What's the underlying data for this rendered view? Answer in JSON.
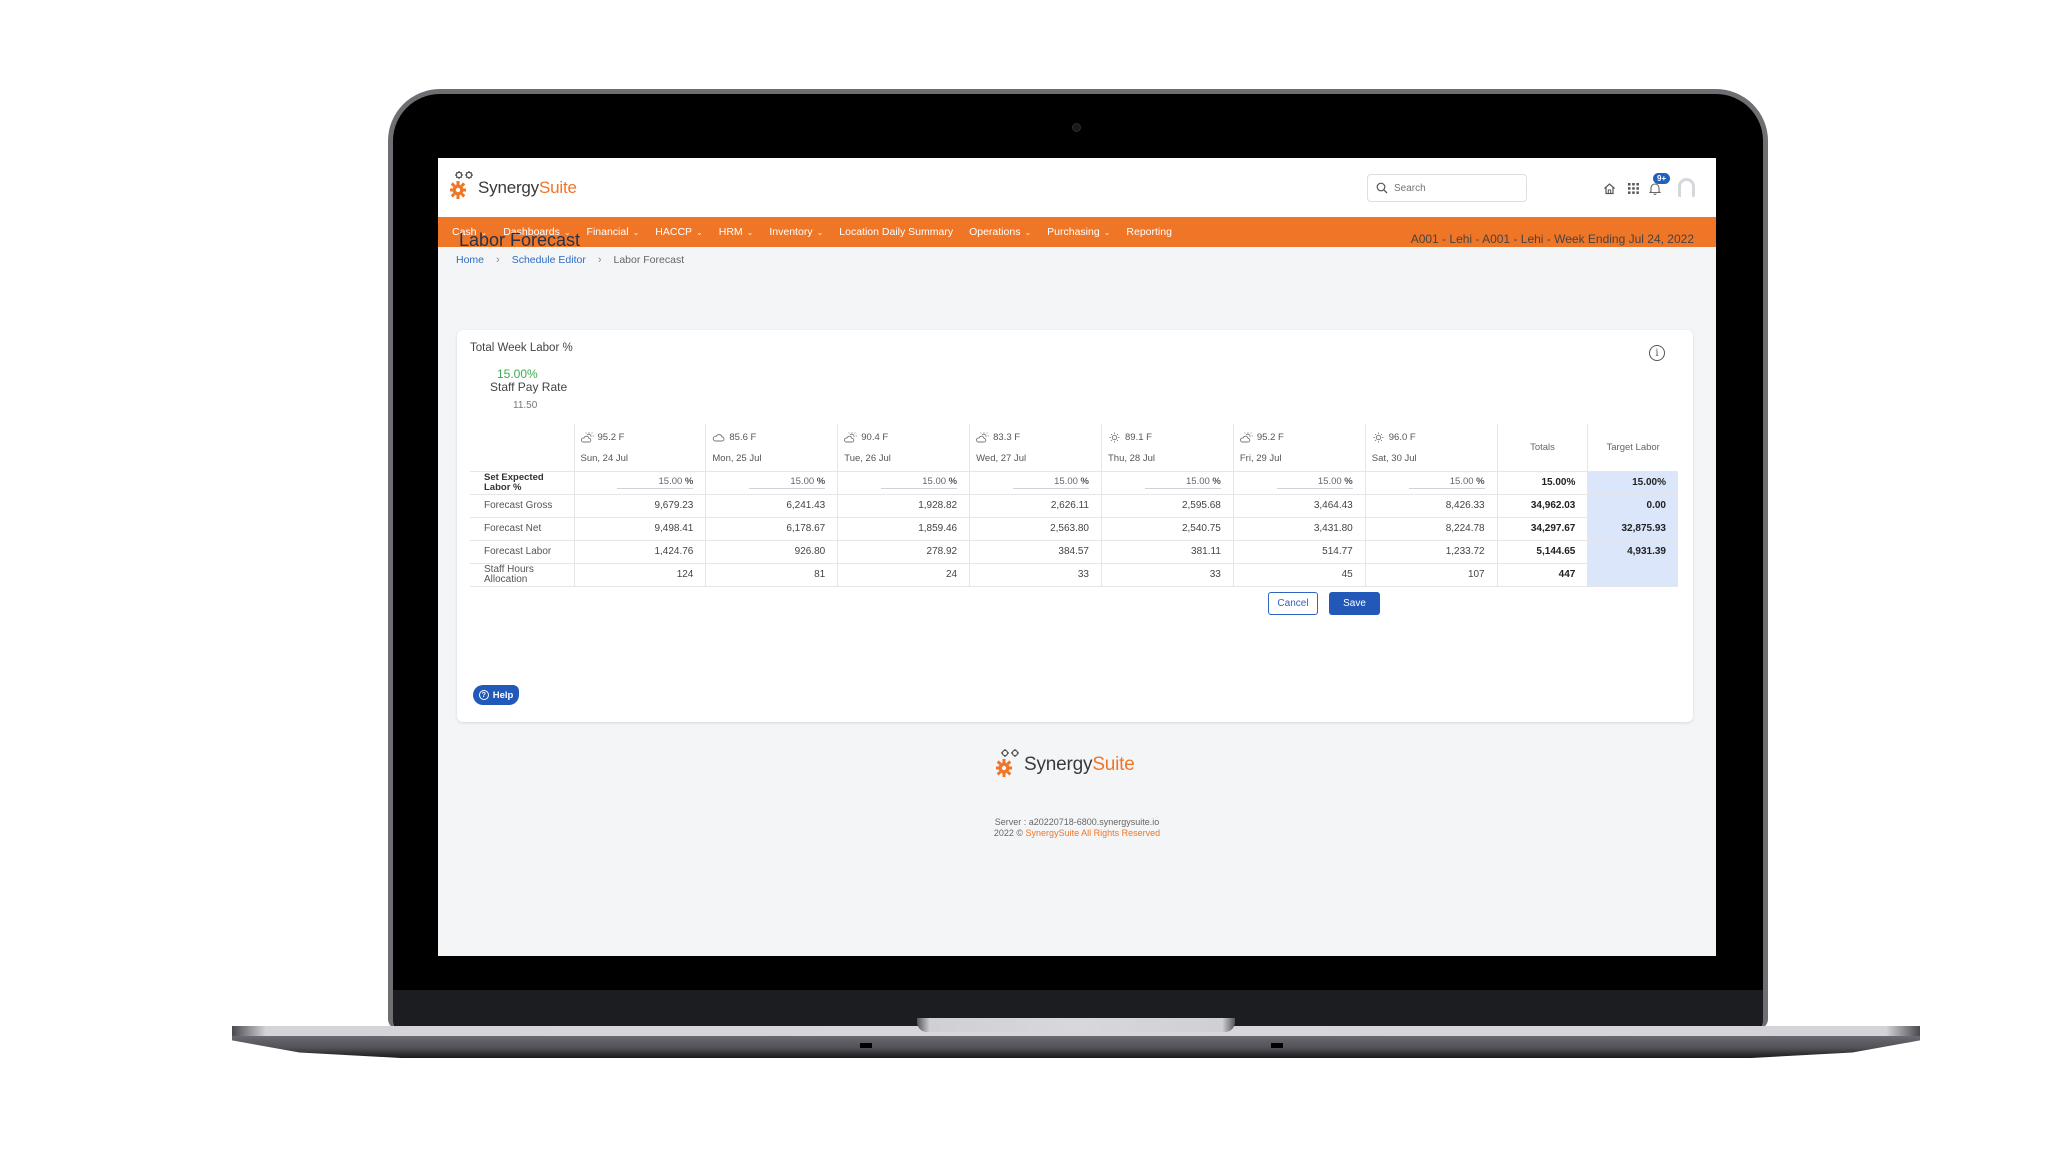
{
  "app": {
    "brand_primary": "Synergy",
    "brand_secondary": "Suite",
    "accent_color": "#ef7627",
    "link_color": "#2f6cc2"
  },
  "header": {
    "search_placeholder": "Search",
    "notification_badge": "9+",
    "icons": [
      "home-icon",
      "apps-grid-icon",
      "bell-icon",
      "avatar"
    ]
  },
  "nav": {
    "items": [
      {
        "label": "Cash",
        "dropdown": true
      },
      {
        "label": "Dashboards",
        "dropdown": true
      },
      {
        "label": "Financial",
        "dropdown": true
      },
      {
        "label": "HACCP",
        "dropdown": true
      },
      {
        "label": "HRM",
        "dropdown": true
      },
      {
        "label": "Inventory",
        "dropdown": true
      },
      {
        "label": "Location Daily Summary",
        "dropdown": false
      },
      {
        "label": "Operations",
        "dropdown": true
      },
      {
        "label": "Purchasing",
        "dropdown": true
      },
      {
        "label": "Reporting",
        "dropdown": false
      }
    ]
  },
  "breadcrumb": {
    "items": [
      "Home",
      "Schedule Editor"
    ],
    "current": "Labor Forecast"
  },
  "page": {
    "title": "Labor Forecast",
    "location": "A001 - Lehi - A001 - Lehi - Week Ending Jul 24, 2022"
  },
  "summary": {
    "heading": "Total Week Labor %",
    "labor_pct": "15.00%",
    "pay_rate_label": "Staff Pay Rate",
    "pay_rate": "11.50"
  },
  "table": {
    "days": [
      {
        "weather": "partly-cloudy",
        "temp": "95.2 F",
        "date": "Sun, 24 Jul"
      },
      {
        "weather": "cloudy",
        "temp": "85.6 F",
        "date": "Mon, 25 Jul"
      },
      {
        "weather": "partly-cloudy",
        "temp": "90.4 F",
        "date": "Tue, 26 Jul"
      },
      {
        "weather": "partly-cloudy",
        "temp": "83.3 F",
        "date": "Wed, 27 Jul"
      },
      {
        "weather": "sunny",
        "temp": "89.1 F",
        "date": "Thu, 28 Jul"
      },
      {
        "weather": "partly-cloudy",
        "temp": "95.2 F",
        "date": "Fri, 29 Jul"
      },
      {
        "weather": "sunny",
        "temp": "96.0 F",
        "date": "Sat, 30 Jul"
      }
    ],
    "totals_header": "Totals",
    "target_header": "Target Labor",
    "percent_unit": "%",
    "rows": [
      {
        "label": "Set Expected Labor %",
        "editable": true,
        "values": [
          "15.00",
          "15.00",
          "15.00",
          "15.00",
          "15.00",
          "15.00",
          "15.00"
        ],
        "total": "15.00%",
        "target": "15.00%"
      },
      {
        "label": "Forecast Gross",
        "values": [
          "9,679.23",
          "6,241.43",
          "1,928.82",
          "2,626.11",
          "2,595.68",
          "3,464.43",
          "8,426.33"
        ],
        "total": "34,962.03",
        "target": "0.00"
      },
      {
        "label": "Forecast Net",
        "values": [
          "9,498.41",
          "6,178.67",
          "1,859.46",
          "2,563.80",
          "2,540.75",
          "3,431.80",
          "8,224.78"
        ],
        "total": "34,297.67",
        "target": "32,875.93"
      },
      {
        "label": "Forecast Labor",
        "values": [
          "1,424.76",
          "926.80",
          "278.92",
          "384.57",
          "381.11",
          "514.77",
          "1,233.72"
        ],
        "total": "5,144.65",
        "target": "4,931.39"
      },
      {
        "label": "Staff Hours Allocation",
        "values": [
          "124",
          "81",
          "24",
          "33",
          "33",
          "45",
          "107"
        ],
        "total": "447",
        "target": ""
      }
    ]
  },
  "actions": {
    "cancel_label": "Cancel",
    "save_label": "Save"
  },
  "footer": {
    "server": "Server : a20220718-6800.synergysuite.io",
    "year": "2022 ©",
    "rights": "SynergySuite All Rights Reserved"
  },
  "help": {
    "label": "Help"
  }
}
